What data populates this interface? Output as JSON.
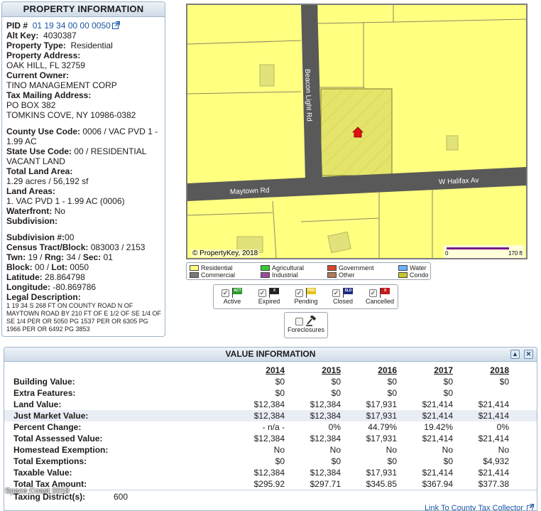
{
  "property": {
    "title": "PROPERTY INFORMATION",
    "pid_label": "PID #",
    "pid_value": "01 19 34 00 00 0050",
    "alt_key_label": "Alt Key:",
    "alt_key_value": "4030387",
    "type_label": "Property Type:",
    "type_value": "Residential",
    "address_label": "Property Address:",
    "address_value": "OAK HILL, FL 32759",
    "owner_label": "Current Owner:",
    "owner_value": "TINO MANAGEMENT CORP",
    "mailing_label": "Tax Mailing Address:",
    "mailing_line1": "PO BOX 382",
    "mailing_line2": "TOMKINS COVE, NY 10986-0382",
    "county_use_label": "County Use Code:",
    "county_use_value": "0006 / VAC PVD 1 -",
    "county_use_value2": "1.99 AC",
    "state_use_label": "State Use Code:",
    "state_use_value": "00 / RESIDENTIAL",
    "state_use_value2": "VACANT LAND",
    "land_area_label": "Total Land Area:",
    "land_area_value": "1.29 acres / 56,192 sf",
    "land_areas_label": "Land Areas:",
    "land_areas_value": "1. VAC PVD 1 - 1.99 AC (0006)",
    "waterfront_label": "Waterfront:",
    "waterfront_value": "No",
    "subdivision_label": "Subdivision:",
    "subdivision_num_label": "Subdivision #:",
    "subdivision_num_value": "00",
    "census_label": "Census Tract/Block:",
    "census_value": "083003 / 2153",
    "twn_label": "Twn:",
    "twn_value": "19 /",
    "rng_label": "Rng:",
    "rng_value": "34 /",
    "sec_label": "Sec:",
    "sec_value": "01",
    "block_label": "Block:",
    "block_value": "00 /",
    "lot_label": "Lot:",
    "lot_value": "0050",
    "lat_label": "Latitude:",
    "lat_value": "28.864798",
    "lon_label": "Longitude:",
    "lon_value": "-80.869786",
    "legal_label": "Legal Description:",
    "legal_value": "1 19 34 S 268 FT ON COUNTY ROAD N OF MAYTOWN ROAD BY 210 FT OF E 1/2 OF SE 1/4 OF SE 1/4 PER OR 5050 PG 1537 PER OR 6305 PG 1966 PER OR 6492 PG 3853"
  },
  "map": {
    "streets": {
      "beacon": "Beacon Light Rd",
      "maytown": "Maytown Rd",
      "halifax": "W Halifax Av"
    },
    "copyright": "© PropertyKey, 2018",
    "scale_min": "0",
    "scale_max": "170 ft",
    "colors": {
      "parcel": "#ffff80",
      "road": "#595959",
      "subject": "#e0e060",
      "marker": "#e01010"
    }
  },
  "legend": [
    {
      "label": "Residential",
      "color": "#ffff80"
    },
    {
      "label": "Commercial",
      "color": "#7a7a7a"
    },
    {
      "label": "Agricultural",
      "color": "#33cc33"
    },
    {
      "label": "Industrial",
      "color": "#9a4c9a"
    },
    {
      "label": "Government",
      "color": "#d2492b"
    },
    {
      "label": "Other",
      "color": "#b07b5a"
    },
    {
      "label": "Water",
      "color": "#66b3ff"
    },
    {
      "label": "Condo",
      "color": "#c7c72a"
    }
  ],
  "filters": [
    {
      "label": "Active",
      "tag": "ACT",
      "color": "#2e9a2e",
      "checked": true
    },
    {
      "label": "Expired",
      "tag": "X",
      "color": "#222222",
      "checked": true
    },
    {
      "label": "Pending",
      "tag": "PND",
      "color": "#e6c21a",
      "checked": true
    },
    {
      "label": "Closed",
      "tag": "SLD",
      "color": "#1c2a80",
      "checked": true
    },
    {
      "label": "Cancelled",
      "tag": "X",
      "color": "#c21b1b",
      "checked": true
    }
  ],
  "foreclosures": {
    "label": "Foreclosures",
    "checked": false,
    "icon": "gavel-icon"
  },
  "value_info": {
    "title": "VALUE INFORMATION",
    "years": [
      "2014",
      "2015",
      "2016",
      "2017",
      "2018"
    ],
    "rows": [
      {
        "label": "Building Value:",
        "values": [
          "$0",
          "$0",
          "$0",
          "$0",
          "$0"
        ]
      },
      {
        "label": "Extra Features:",
        "values": [
          "$0",
          "$0",
          "$0",
          "$0",
          ""
        ]
      },
      {
        "label": "Land Value:",
        "values": [
          "$12,384",
          "$12,384",
          "$17,931",
          "$21,414",
          "$21,414"
        ]
      },
      {
        "label": "Just Market Value:",
        "values": [
          "$12,384",
          "$12,384",
          "$17,931",
          "$21,414",
          "$21,414"
        ]
      },
      {
        "label": "Percent Change:",
        "values": [
          "- n/a -",
          "0%",
          "44.79%",
          "19.42%",
          "0%"
        ]
      },
      {
        "label": "Total Assessed Value:",
        "values": [
          "$12,384",
          "$12,384",
          "$17,931",
          "$21,414",
          "$21,414"
        ]
      },
      {
        "label": "Homestead Exemption:",
        "values": [
          "No",
          "No",
          "No",
          "No",
          "No"
        ]
      },
      {
        "label": "Total Exemptions:",
        "values": [
          "$0",
          "$0",
          "$0",
          "$0",
          "$4,932"
        ]
      },
      {
        "label": "Taxable Value:",
        "values": [
          "$12,384",
          "$12,384",
          "$17,931",
          "$21,414",
          "$21,414"
        ]
      },
      {
        "label": "Total Tax Amount:",
        "values": [
          "$295.92",
          "$297.71",
          "$345.85",
          "$367.94",
          "$377.38"
        ]
      }
    ],
    "taxing_label": "Taxing District(s):",
    "taxing_value": "600",
    "collector_link": "Link To County Tax Collector",
    "watermark": "Space Coast 2018"
  }
}
